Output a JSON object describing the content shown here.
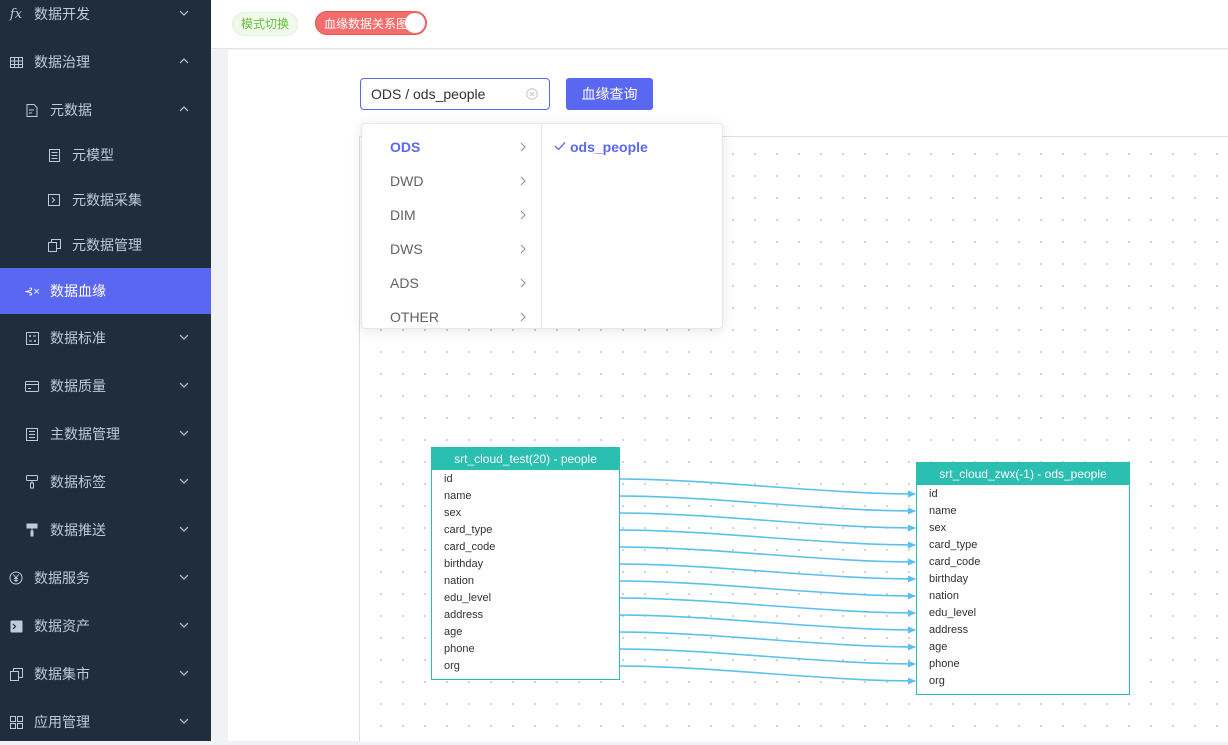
{
  "sidebar": {
    "items": [
      {
        "label": "数据开发",
        "icon": "fx-icon",
        "name": "sidebar-item-data-dev",
        "level": 1,
        "expanded": false
      },
      {
        "label": "数据治理",
        "icon": "grid-icon",
        "name": "sidebar-item-data-governance",
        "level": 1,
        "expanded": true
      },
      {
        "label": "元数据",
        "icon": "file-icon",
        "name": "sidebar-item-metadata",
        "level": 2,
        "expanded": true
      },
      {
        "label": "元模型",
        "icon": "doc-list-icon",
        "name": "sidebar-item-meta-model",
        "level": 3
      },
      {
        "label": "元数据采集",
        "icon": "terminal-icon",
        "name": "sidebar-item-metadata-collect",
        "level": 3
      },
      {
        "label": "元数据管理",
        "icon": "copy-icon",
        "name": "sidebar-item-metadata-manage",
        "level": 3
      },
      {
        "label": "数据血缘",
        "icon": "lineage-icon",
        "name": "sidebar-item-data-lineage",
        "level": 2,
        "active": true
      },
      {
        "label": "数据标准",
        "icon": "standard-icon",
        "name": "sidebar-item-data-standard",
        "level": 2,
        "expanded": false
      },
      {
        "label": "数据质量",
        "icon": "card-icon",
        "name": "sidebar-item-data-quality",
        "level": 2,
        "expanded": false
      },
      {
        "label": "主数据管理",
        "icon": "list-icon",
        "name": "sidebar-item-master-data",
        "level": 2,
        "expanded": false
      },
      {
        "label": "数据标签",
        "icon": "brush-icon",
        "name": "sidebar-item-data-tag",
        "level": 2,
        "expanded": false
      },
      {
        "label": "数据推送",
        "icon": "roller-icon",
        "name": "sidebar-item-data-push",
        "level": 2,
        "expanded": false
      },
      {
        "label": "数据服务",
        "icon": "yen-icon",
        "name": "sidebar-item-data-service",
        "level": 1,
        "expanded": false
      },
      {
        "label": "数据资产",
        "icon": "console-icon",
        "name": "sidebar-item-data-asset",
        "level": 1,
        "expanded": false
      },
      {
        "label": "数据集市",
        "icon": "copy-icon",
        "name": "sidebar-item-data-mart",
        "level": 1,
        "expanded": false
      },
      {
        "label": "应用管理",
        "icon": "apps-icon",
        "name": "sidebar-item-app-manage",
        "level": 1,
        "expanded": false
      }
    ]
  },
  "topbar": {
    "mode_tag": "模式切换",
    "switch_label": "血缘数据关系图"
  },
  "query": {
    "cascader_value": "ODS / ods_people",
    "query_button": "血缘查询"
  },
  "dropdown": {
    "level1": [
      "ODS",
      "DWD",
      "DIM",
      "DWS",
      "ADS",
      "OTHER"
    ],
    "selected_level1": "ODS",
    "level2": [
      "ods_people"
    ],
    "selected_level2": "ods_people"
  },
  "graph": {
    "colors": {
      "header": "#2bbfb1",
      "edge": "#5bc0ee"
    },
    "source": {
      "title": "srt_cloud_test(20) - people",
      "fields": [
        "id",
        "name",
        "sex",
        "card_type",
        "card_code",
        "birthday",
        "nation",
        "edu_level",
        "address",
        "age",
        "phone",
        "org"
      ]
    },
    "target": {
      "title": "srt_cloud_zwx(-1) - ods_people",
      "fields": [
        "id",
        "name",
        "sex",
        "card_type",
        "card_code",
        "birthday",
        "nation",
        "edu_level",
        "address",
        "age",
        "phone",
        "org"
      ]
    }
  }
}
